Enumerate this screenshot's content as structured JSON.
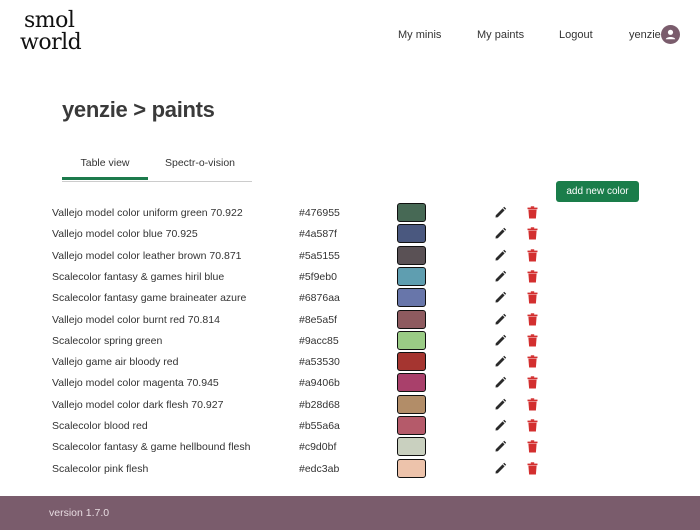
{
  "logo": {
    "line1": "smol",
    "line2": "world"
  },
  "nav": {
    "minis": "My minis",
    "paints": "My paints",
    "logout": "Logout",
    "user": "yenzie"
  },
  "page_title": "yenzie > paints",
  "tabs": [
    {
      "label": "Table view"
    },
    {
      "label": "Spectr-o-vision"
    }
  ],
  "add_button": "add new color",
  "paints": [
    {
      "name": "Vallejo model color uniform green 70.922",
      "hex": "#476955"
    },
    {
      "name": "Vallejo model color blue 70.925",
      "hex": "#4a587f"
    },
    {
      "name": "Vallejo model color leather brown 70.871",
      "hex": "#5a5155"
    },
    {
      "name": "Scalecolor fantasy & games hiril blue",
      "hex": "#5f9eb0"
    },
    {
      "name": "Scalecolor fantasy game braineater azure",
      "hex": "#6876aa"
    },
    {
      "name": "Vallejo model color burnt red 70.814",
      "hex": "#8e5a5f"
    },
    {
      "name": "Scalecolor spring green",
      "hex": "#9acc85"
    },
    {
      "name": "Vallejo game air bloody red",
      "hex": "#a53530"
    },
    {
      "name": "Vallejo model color magenta 70.945",
      "hex": "#a9406b"
    },
    {
      "name": "Vallejo model color dark flesh 70.927",
      "hex": "#b28d68"
    },
    {
      "name": "Scalecolor blood red",
      "hex": "#b55a6a"
    },
    {
      "name": "Scalecolor fantasy & game hellbound flesh",
      "hex": "#c9d0bf"
    },
    {
      "name": "Scalecolor pink flesh",
      "hex": "#edc3ab"
    }
  ],
  "footer": {
    "version": "version 1.7.0"
  },
  "colors": {
    "accent": "#1a7d4a",
    "footer": "#7a5c6c",
    "delete": "#d32f2f"
  }
}
